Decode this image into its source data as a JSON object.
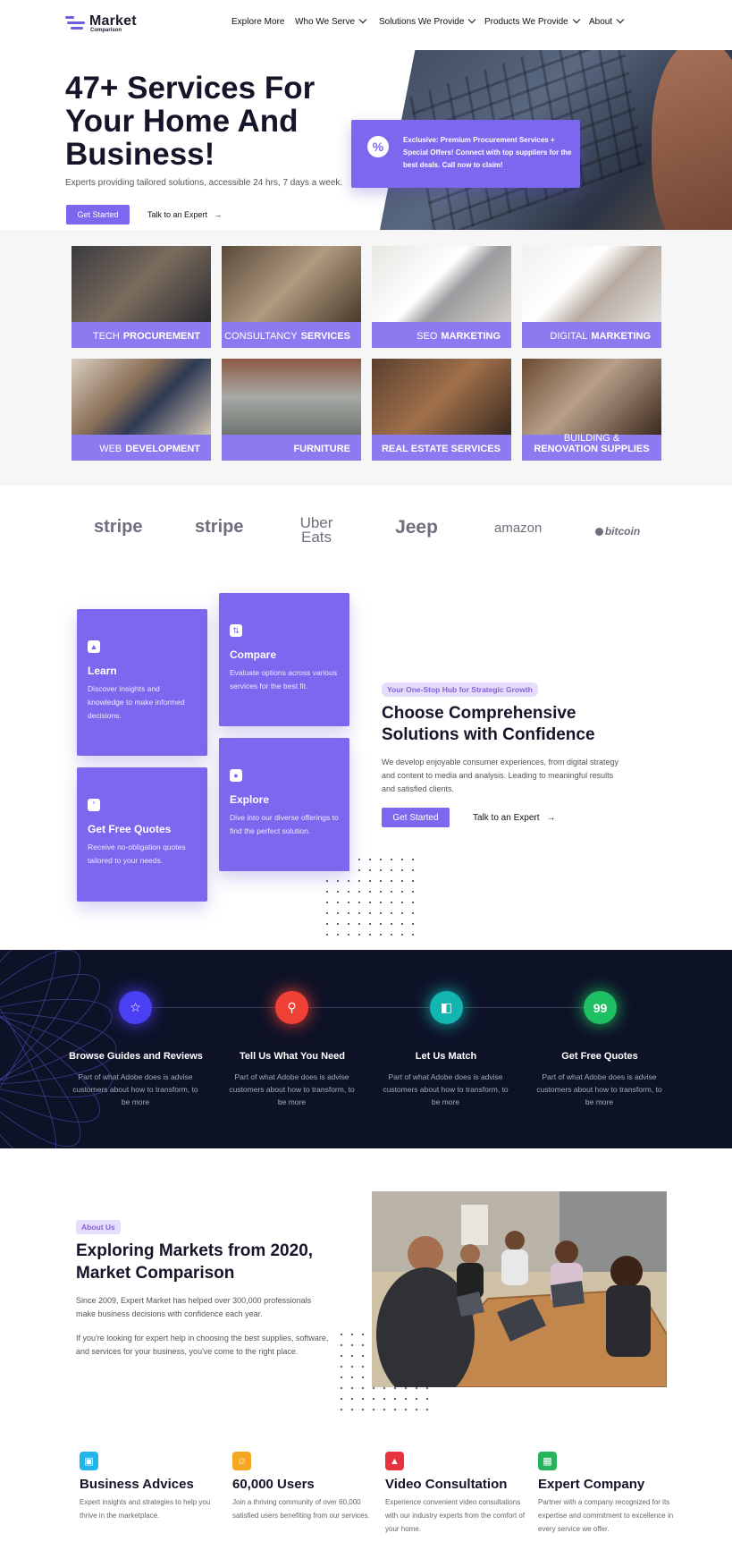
{
  "header": {
    "logo_name": "Market",
    "logo_sub": "Comparison",
    "nav": [
      "Explore More",
      "Who We Serve",
      "Solutions We Provide",
      "Products We Provide",
      "About"
    ]
  },
  "hero": {
    "title": "47+ Services For Your Home And Business!",
    "subtitle": "Experts providing tailored solutions, accessible 24 hrs, 7 days a week.",
    "cta_primary": "Get Started",
    "cta_secondary": "Talk to an Expert",
    "promo_text": "Exclusive: Premium Procurement Services + Special Offers! Connect with top suppliers for the best deals. Call now to claim!"
  },
  "services": [
    {
      "light": "TECH",
      "bold": "PROCUREMENT"
    },
    {
      "light": "CONSULTANCY",
      "bold": "SERVICES"
    },
    {
      "light": "SEO",
      "bold": "MARKETING"
    },
    {
      "light": "DIGITAL",
      "bold": "MARKETING"
    },
    {
      "light": "WEB",
      "bold": "DEVELOPMENT"
    },
    {
      "light": "",
      "bold": "FURNITURE"
    },
    {
      "light": "",
      "bold": "REAL ESTATE SERVICES"
    },
    {
      "light": "BUILDING &",
      "bold": "RENOVATION SUPPLIES"
    }
  ],
  "brands": [
    "stripe",
    "stripe",
    "Uber Eats",
    "Jeep",
    "amazon",
    "bitcoin"
  ],
  "features": {
    "cards": [
      {
        "title": "Learn",
        "text": "Discover insights and knowledge to make informed decisions."
      },
      {
        "title": "Compare",
        "text": "Evaluate options across various services for the best fit."
      },
      {
        "title": "Get Free Quotes",
        "text": "Receive no-obligation quotes tailored to your needs."
      },
      {
        "title": "Explore",
        "text": "Dive into our diverse offerings to find the perfect solution."
      }
    ],
    "tag": "Your One-Stop Hub for Strategic Growth",
    "title": "Choose Comprehensive Solutions with Confidence",
    "text": "We develop enjoyable consumer experiences, from digital strategy and content to media and analysis. Leading to meaningful results and satisfied clients.",
    "cta_primary": "Get Started",
    "cta_secondary": "Talk to an Expert"
  },
  "steps": [
    {
      "title": "Browse Guides and Reviews",
      "text": "Part of what Adobe does is advise customers about how to transform, to be more",
      "color": "#4a3ff2"
    },
    {
      "title": "Tell Us What You Need",
      "text": "Part of what Adobe does is advise customers about how to transform, to be more",
      "color": "#ef4136"
    },
    {
      "title": "Let Us Match",
      "text": "Part of what Adobe does is advise customers about how to transform, to be more",
      "color": "#13b5b1"
    },
    {
      "title": "Get Free Quotes",
      "text": "Part of what Adobe does is advise customers about how to transform, to be more",
      "color": "#1fbf63"
    }
  ],
  "about": {
    "tag": "About Us",
    "title": "Exploring Markets from 2020, Market Comparison",
    "p1": "Since 2009, Expert Market has helped over 300,000 professionals make business decisions with confidence each year.",
    "p2": "If you're looking for expert help in choosing the best supplies, software, and services for your business, you've come to the right place."
  },
  "stats": [
    {
      "title": "Business Advices",
      "text": "Expert insights and strategies to help you thrive in the marketplace.",
      "color": "#22b4ea"
    },
    {
      "title": "60,000 Users",
      "text": "Join a thriving community of over 60,000 satisfied users benefiting from our services.",
      "color": "#f5a623"
    },
    {
      "title": "Video Consultation",
      "text": "Experience convenient video consultations with our industry experts from the comfort of your home.",
      "color": "#e5343f"
    },
    {
      "title": "Expert Company",
      "text": "Partner with a company recognized for its expertise and commitment to excellence in every service we offer.",
      "color": "#25b45c"
    }
  ]
}
